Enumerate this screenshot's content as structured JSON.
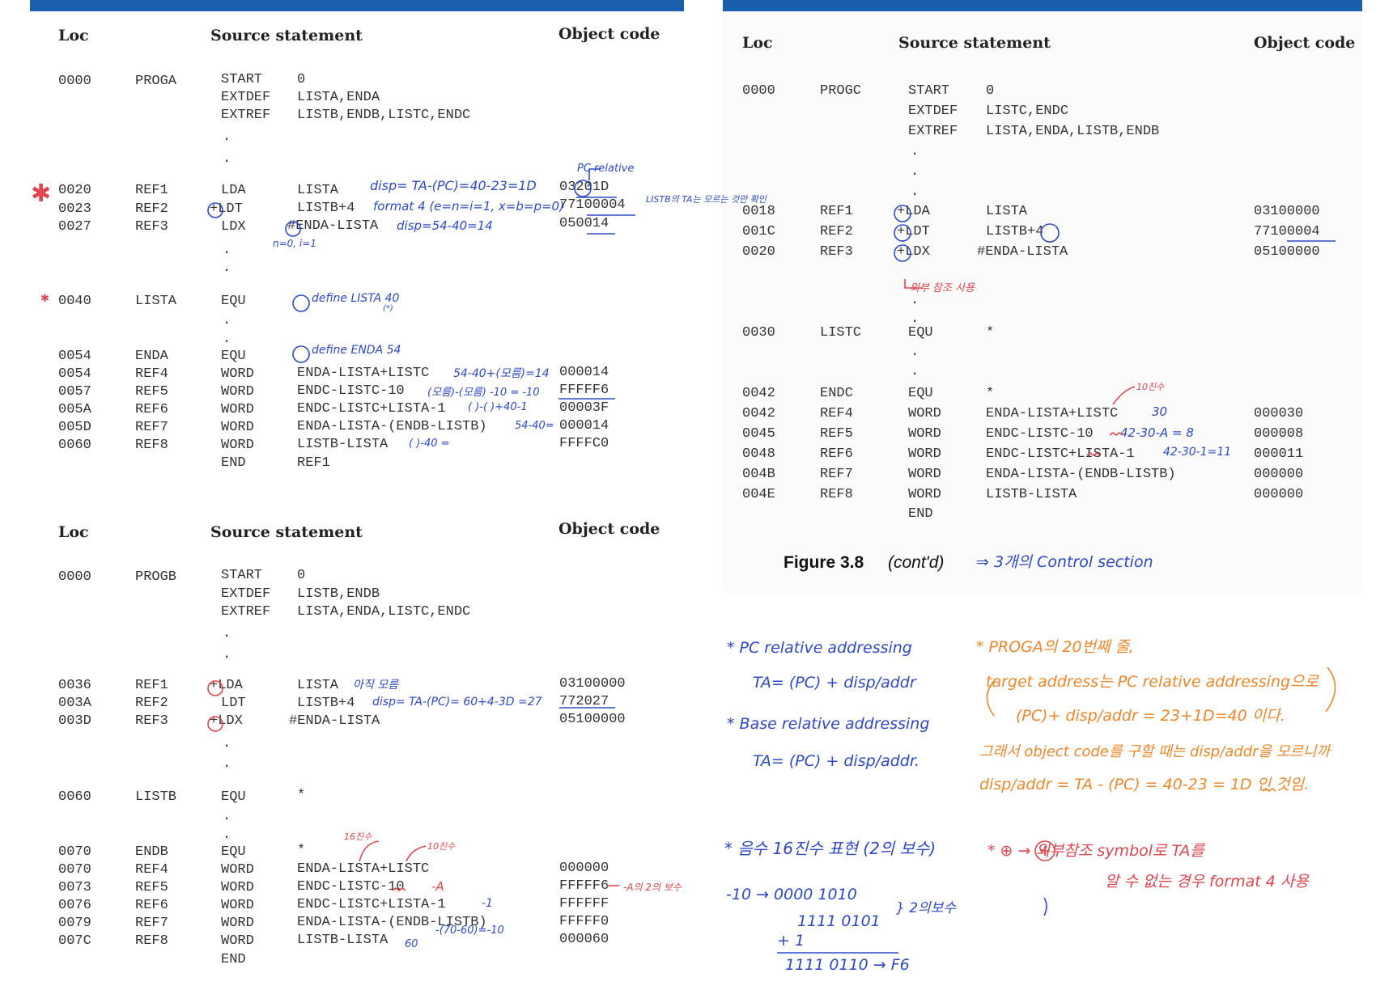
{
  "colors": {
    "bar": "#1a5fae",
    "ink_blue": "#2d49c9",
    "ink_orange": "#f0862a",
    "ink_red": "#e0464e",
    "text": "#333333"
  },
  "headers": {
    "loc": "Loc",
    "source": "Source statement",
    "object": "Object code"
  },
  "progA": {
    "start": {
      "loc": "0000",
      "label": "PROGA",
      "op": "START",
      "arg": "0"
    },
    "extdef": {
      "op": "EXTDEF",
      "arg": "LISTA,ENDA"
    },
    "extref": {
      "op": "EXTREF",
      "arg": "LISTB,ENDB,LISTC,ENDC"
    },
    "rows": [
      {
        "loc": "0020",
        "label": "REF1",
        "op": "LDA",
        "arg": "LISTA",
        "obj": "03201D"
      },
      {
        "loc": "0023",
        "label": "REF2",
        "op": "+LDT",
        "arg": "LISTB+4",
        "obj": "77100004"
      },
      {
        "loc": "0027",
        "label": "REF3",
        "op": "LDX",
        "arg": "#ENDA-LISTA",
        "obj": "050014"
      },
      {
        "loc": "0040",
        "label": "LISTA",
        "op": "EQU",
        "arg": "",
        "obj": ""
      },
      {
        "loc": "0054",
        "label": "ENDA",
        "op": "EQU",
        "arg": "",
        "obj": ""
      },
      {
        "loc": "0054",
        "label": "REF4",
        "op": "WORD",
        "arg": "ENDA-LISTA+LISTC",
        "obj": "000014"
      },
      {
        "loc": "0057",
        "label": "REF5",
        "op": "WORD",
        "arg": "ENDC-LISTC-10",
        "obj": "FFFFF6"
      },
      {
        "loc": "005A",
        "label": "REF6",
        "op": "WORD",
        "arg": "ENDC-LISTC+LISTA-1",
        "obj": "00003F"
      },
      {
        "loc": "005D",
        "label": "REF7",
        "op": "WORD",
        "arg": "ENDA-LISTA-(ENDB-LISTB)",
        "obj": "000014"
      },
      {
        "loc": "0060",
        "label": "REF8",
        "op": "WORD",
        "arg": "LISTB-LISTA",
        "obj": "FFFFC0"
      },
      {
        "loc": "",
        "label": "",
        "op": "END",
        "arg": "REF1",
        "obj": ""
      }
    ]
  },
  "progB": {
    "start": {
      "loc": "0000",
      "label": "PROGB",
      "op": "START",
      "arg": "0"
    },
    "extdef": {
      "op": "EXTDEF",
      "arg": "LISTB,ENDB"
    },
    "extref": {
      "op": "EXTREF",
      "arg": "LISTA,ENDA,LISTC,ENDC"
    },
    "rows": [
      {
        "loc": "0036",
        "label": "REF1",
        "op": "+LDA",
        "arg": "LISTA",
        "obj": "03100000"
      },
      {
        "loc": "003A",
        "label": "REF2",
        "op": "LDT",
        "arg": "LISTB+4",
        "obj": "772027"
      },
      {
        "loc": "003D",
        "label": "REF3",
        "op": "+LDX",
        "arg": "#ENDA-LISTA",
        "obj": "05100000"
      },
      {
        "loc": "0060",
        "label": "LISTB",
        "op": "EQU",
        "arg": "*",
        "obj": ""
      },
      {
        "loc": "0070",
        "label": "ENDB",
        "op": "EQU",
        "arg": "*",
        "obj": ""
      },
      {
        "loc": "0070",
        "label": "REF4",
        "op": "WORD",
        "arg": "ENDA-LISTA+LISTC",
        "obj": "000000"
      },
      {
        "loc": "0073",
        "label": "REF5",
        "op": "WORD",
        "arg": "ENDC-LISTC-10",
        "obj": "FFFFF6"
      },
      {
        "loc": "0076",
        "label": "REF6",
        "op": "WORD",
        "arg": "ENDC-LISTC+LISTA-1",
        "obj": "FFFFFF"
      },
      {
        "loc": "0079",
        "label": "REF7",
        "op": "WORD",
        "arg": "ENDA-LISTA-(ENDB-LISTB)",
        "obj": "FFFFF0"
      },
      {
        "loc": "007C",
        "label": "REF8",
        "op": "WORD",
        "arg": "LISTB-LISTA",
        "obj": "000060"
      },
      {
        "loc": "",
        "label": "",
        "op": "END",
        "arg": "",
        "obj": ""
      }
    ]
  },
  "progC": {
    "start": {
      "loc": "0000",
      "label": "PROGC",
      "op": "START",
      "arg": "0"
    },
    "extdef": {
      "op": "EXTDEF",
      "arg": "LISTC,ENDC"
    },
    "extref": {
      "op": "EXTREF",
      "arg": "LISTA,ENDA,LISTB,ENDB"
    },
    "rows": [
      {
        "loc": "0018",
        "label": "REF1",
        "op": "+LDA",
        "arg": "LISTA",
        "obj": "03100000"
      },
      {
        "loc": "001C",
        "label": "REF2",
        "op": "+LDT",
        "arg": "LISTB+4",
        "obj": "77100004"
      },
      {
        "loc": "0020",
        "label": "REF3",
        "op": "+LDX",
        "arg": "#ENDA-LISTA",
        "obj": "05100000"
      },
      {
        "loc": "0030",
        "label": "LISTC",
        "op": "EQU",
        "arg": "*",
        "obj": ""
      },
      {
        "loc": "0042",
        "label": "ENDC",
        "op": "EQU",
        "arg": "*",
        "obj": ""
      },
      {
        "loc": "0042",
        "label": "REF4",
        "op": "WORD",
        "arg": "ENDA-LISTA+LISTC",
        "obj": "000030"
      },
      {
        "loc": "0045",
        "label": "REF5",
        "op": "WORD",
        "arg": "ENDC-LISTC-10",
        "obj": "000008"
      },
      {
        "loc": "0048",
        "label": "REF6",
        "op": "WORD",
        "arg": "ENDC-LISTC+LISTA-1",
        "obj": "000011"
      },
      {
        "loc": "004B",
        "label": "REF7",
        "op": "WORD",
        "arg": "ENDA-LISTA-(ENDB-LISTB)",
        "obj": "000000"
      },
      {
        "loc": "004E",
        "label": "REF8",
        "op": "WORD",
        "arg": "LISTB-LISTA",
        "obj": "000000"
      },
      {
        "loc": "",
        "label": "",
        "op": "END",
        "arg": "",
        "obj": ""
      }
    ]
  },
  "caption": {
    "fig": "Figure 3.8",
    "cont": "(cont'd)"
  },
  "notes": {
    "a_ref1": "disp= TA-(PC)=40-23=1D",
    "a_pcrel": "PC relative",
    "a_ref2": "format 4 (e=n=i=1, x=b=p=0)",
    "a_listb": "LISTB의 TA는 모르는 것만 확인",
    "a_ref3": "disp=54-40=14",
    "a_ni": "n=0, i=1",
    "a_lista": "define LISTA 40",
    "a_star": "(*)",
    "a_enda": "define ENDA 54",
    "a_ref4": "54-40+(모름)=14",
    "a_ref5": "(모름)-(모름) -10 = -10",
    "a_ref6": "( )-( )+40-1",
    "a_ref7": "54-40=",
    "a_ref8": "( )-40 =",
    "b_ref1": "아직 모름",
    "b_ref2": "disp= TA-(PC)= 60+4-3D =27",
    "b_60": "60",
    "b_16": "16진수",
    "b_10": "10진수",
    "b_a": "-A",
    "b_neg": "-A의 2의 보수",
    "b_one": "-1",
    "b_ref7": "-(70-60)=-10",
    "c_ext": "외부 참조 사용",
    "c_10": "10진수",
    "c_ref4": "30",
    "c_ref5": "42-30-A = 8",
    "c_ref6": "42-30-1=11",
    "c_cs": "⇒ 3개의 Control section",
    "n_pc1": "* PC relative addressing",
    "n_pc2": "TA= (PC) + disp/addr",
    "n_b1": "* Base relative addressing",
    "n_b2": "TA= (PC) + disp/addr.",
    "n_neg": "* 음수 16진수 표현 (2의 보수)",
    "n_neg1": "-10 → 0000 1010",
    "n_neg2": "1111 0101",
    "n_neg2b": "} 2의보수",
    "n_neg3": "+        1",
    "n_neg4": "1111 0110 → F6",
    "o_1": "* PROGA의 20번째 줄,",
    "o_2": "target address는 PC relative addressing으로",
    "o_3": "(PC)+ disp/addr = 23+1D=40 이다.",
    "o_4": "그래서 object code를 구할 때는 disp/addr을 모르니까",
    "o_5": "disp/addr = TA - (PC) = 40-23 = 1D 인 것임.",
    "r_1": "* ⊕ → 외부참조 symbol로 TA를",
    "r_2": "알 수 없는 경우 format 4 사용"
  }
}
